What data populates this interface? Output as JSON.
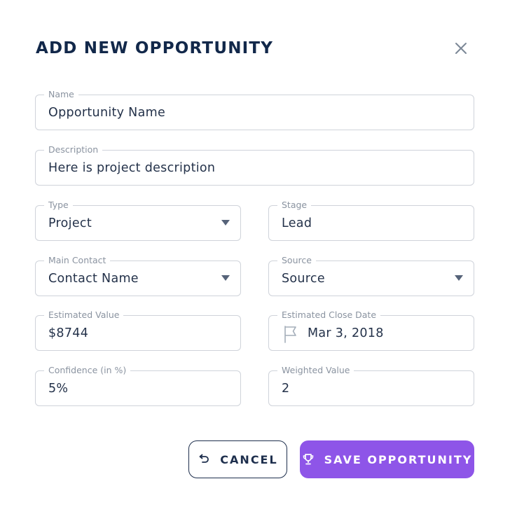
{
  "dialog": {
    "title": "ADD NEW OPPORTUNITY",
    "close_icon": "close-icon"
  },
  "fields": {
    "name": {
      "label": "Name",
      "value": "Opportunity Name"
    },
    "description": {
      "label": "Description",
      "value": "Here is project description"
    },
    "type": {
      "label": "Type",
      "value": "Project"
    },
    "stage": {
      "label": "Stage",
      "value": "Lead"
    },
    "main_contact": {
      "label": "Main Contact",
      "value": "Contact Name"
    },
    "source": {
      "label": "Source",
      "value": "Source"
    },
    "estimated_value": {
      "label": "Estimated Value",
      "value": "$8744"
    },
    "estimated_close_date": {
      "label": "Estimated Close Date",
      "value": "Mar 3, 2018",
      "icon": "flag-icon"
    },
    "confidence": {
      "label": "Confidence (in %)",
      "value": "5%"
    },
    "weighted_value": {
      "label": "Weighted Value",
      "value": "2"
    }
  },
  "actions": {
    "cancel_label": "CANCEL",
    "cancel_icon": "undo-icon",
    "save_label": "SAVE OPPORTUNITY",
    "save_icon": "trophy-icon"
  },
  "colors": {
    "title": "#12284a",
    "border": "#cfd3da",
    "label": "#8a93a0",
    "accent": "#8e55e8"
  }
}
